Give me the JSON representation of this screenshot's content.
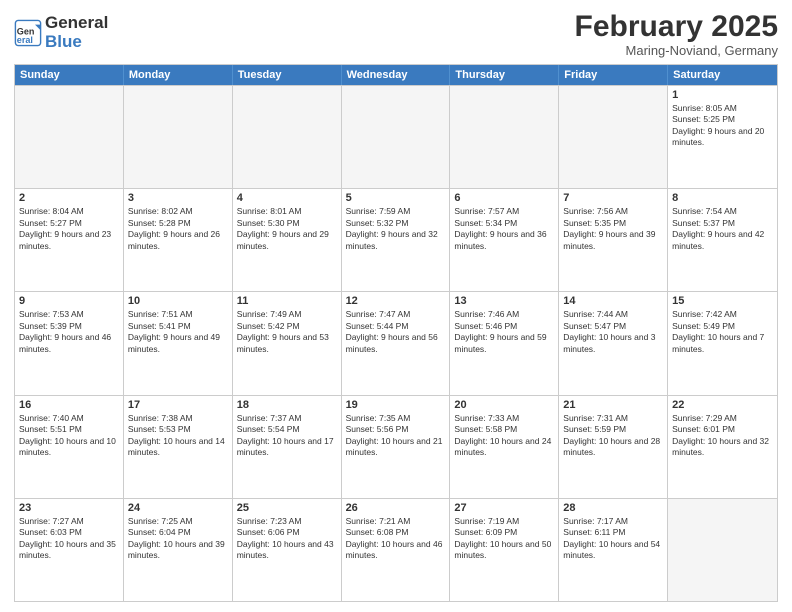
{
  "header": {
    "logo_general": "General",
    "logo_blue": "Blue",
    "month_title": "February 2025",
    "location": "Maring-Noviand, Germany"
  },
  "weekdays": [
    "Sunday",
    "Monday",
    "Tuesday",
    "Wednesday",
    "Thursday",
    "Friday",
    "Saturday"
  ],
  "weeks": [
    [
      {
        "day": "",
        "sunrise": "",
        "sunset": "",
        "daylight": ""
      },
      {
        "day": "",
        "sunrise": "",
        "sunset": "",
        "daylight": ""
      },
      {
        "day": "",
        "sunrise": "",
        "sunset": "",
        "daylight": ""
      },
      {
        "day": "",
        "sunrise": "",
        "sunset": "",
        "daylight": ""
      },
      {
        "day": "",
        "sunrise": "",
        "sunset": "",
        "daylight": ""
      },
      {
        "day": "",
        "sunrise": "",
        "sunset": "",
        "daylight": ""
      },
      {
        "day": "1",
        "sunrise": "Sunrise: 8:05 AM",
        "sunset": "Sunset: 5:25 PM",
        "daylight": "Daylight: 9 hours and 20 minutes."
      }
    ],
    [
      {
        "day": "2",
        "sunrise": "Sunrise: 8:04 AM",
        "sunset": "Sunset: 5:27 PM",
        "daylight": "Daylight: 9 hours and 23 minutes."
      },
      {
        "day": "3",
        "sunrise": "Sunrise: 8:02 AM",
        "sunset": "Sunset: 5:28 PM",
        "daylight": "Daylight: 9 hours and 26 minutes."
      },
      {
        "day": "4",
        "sunrise": "Sunrise: 8:01 AM",
        "sunset": "Sunset: 5:30 PM",
        "daylight": "Daylight: 9 hours and 29 minutes."
      },
      {
        "day": "5",
        "sunrise": "Sunrise: 7:59 AM",
        "sunset": "Sunset: 5:32 PM",
        "daylight": "Daylight: 9 hours and 32 minutes."
      },
      {
        "day": "6",
        "sunrise": "Sunrise: 7:57 AM",
        "sunset": "Sunset: 5:34 PM",
        "daylight": "Daylight: 9 hours and 36 minutes."
      },
      {
        "day": "7",
        "sunrise": "Sunrise: 7:56 AM",
        "sunset": "Sunset: 5:35 PM",
        "daylight": "Daylight: 9 hours and 39 minutes."
      },
      {
        "day": "8",
        "sunrise": "Sunrise: 7:54 AM",
        "sunset": "Sunset: 5:37 PM",
        "daylight": "Daylight: 9 hours and 42 minutes."
      }
    ],
    [
      {
        "day": "9",
        "sunrise": "Sunrise: 7:53 AM",
        "sunset": "Sunset: 5:39 PM",
        "daylight": "Daylight: 9 hours and 46 minutes."
      },
      {
        "day": "10",
        "sunrise": "Sunrise: 7:51 AM",
        "sunset": "Sunset: 5:41 PM",
        "daylight": "Daylight: 9 hours and 49 minutes."
      },
      {
        "day": "11",
        "sunrise": "Sunrise: 7:49 AM",
        "sunset": "Sunset: 5:42 PM",
        "daylight": "Daylight: 9 hours and 53 minutes."
      },
      {
        "day": "12",
        "sunrise": "Sunrise: 7:47 AM",
        "sunset": "Sunset: 5:44 PM",
        "daylight": "Daylight: 9 hours and 56 minutes."
      },
      {
        "day": "13",
        "sunrise": "Sunrise: 7:46 AM",
        "sunset": "Sunset: 5:46 PM",
        "daylight": "Daylight: 9 hours and 59 minutes."
      },
      {
        "day": "14",
        "sunrise": "Sunrise: 7:44 AM",
        "sunset": "Sunset: 5:47 PM",
        "daylight": "Daylight: 10 hours and 3 minutes."
      },
      {
        "day": "15",
        "sunrise": "Sunrise: 7:42 AM",
        "sunset": "Sunset: 5:49 PM",
        "daylight": "Daylight: 10 hours and 7 minutes."
      }
    ],
    [
      {
        "day": "16",
        "sunrise": "Sunrise: 7:40 AM",
        "sunset": "Sunset: 5:51 PM",
        "daylight": "Daylight: 10 hours and 10 minutes."
      },
      {
        "day": "17",
        "sunrise": "Sunrise: 7:38 AM",
        "sunset": "Sunset: 5:53 PM",
        "daylight": "Daylight: 10 hours and 14 minutes."
      },
      {
        "day": "18",
        "sunrise": "Sunrise: 7:37 AM",
        "sunset": "Sunset: 5:54 PM",
        "daylight": "Daylight: 10 hours and 17 minutes."
      },
      {
        "day": "19",
        "sunrise": "Sunrise: 7:35 AM",
        "sunset": "Sunset: 5:56 PM",
        "daylight": "Daylight: 10 hours and 21 minutes."
      },
      {
        "day": "20",
        "sunrise": "Sunrise: 7:33 AM",
        "sunset": "Sunset: 5:58 PM",
        "daylight": "Daylight: 10 hours and 24 minutes."
      },
      {
        "day": "21",
        "sunrise": "Sunrise: 7:31 AM",
        "sunset": "Sunset: 5:59 PM",
        "daylight": "Daylight: 10 hours and 28 minutes."
      },
      {
        "day": "22",
        "sunrise": "Sunrise: 7:29 AM",
        "sunset": "Sunset: 6:01 PM",
        "daylight": "Daylight: 10 hours and 32 minutes."
      }
    ],
    [
      {
        "day": "23",
        "sunrise": "Sunrise: 7:27 AM",
        "sunset": "Sunset: 6:03 PM",
        "daylight": "Daylight: 10 hours and 35 minutes."
      },
      {
        "day": "24",
        "sunrise": "Sunrise: 7:25 AM",
        "sunset": "Sunset: 6:04 PM",
        "daylight": "Daylight: 10 hours and 39 minutes."
      },
      {
        "day": "25",
        "sunrise": "Sunrise: 7:23 AM",
        "sunset": "Sunset: 6:06 PM",
        "daylight": "Daylight: 10 hours and 43 minutes."
      },
      {
        "day": "26",
        "sunrise": "Sunrise: 7:21 AM",
        "sunset": "Sunset: 6:08 PM",
        "daylight": "Daylight: 10 hours and 46 minutes."
      },
      {
        "day": "27",
        "sunrise": "Sunrise: 7:19 AM",
        "sunset": "Sunset: 6:09 PM",
        "daylight": "Daylight: 10 hours and 50 minutes."
      },
      {
        "day": "28",
        "sunrise": "Sunrise: 7:17 AM",
        "sunset": "Sunset: 6:11 PM",
        "daylight": "Daylight: 10 hours and 54 minutes."
      },
      {
        "day": "",
        "sunrise": "",
        "sunset": "",
        "daylight": ""
      }
    ]
  ]
}
